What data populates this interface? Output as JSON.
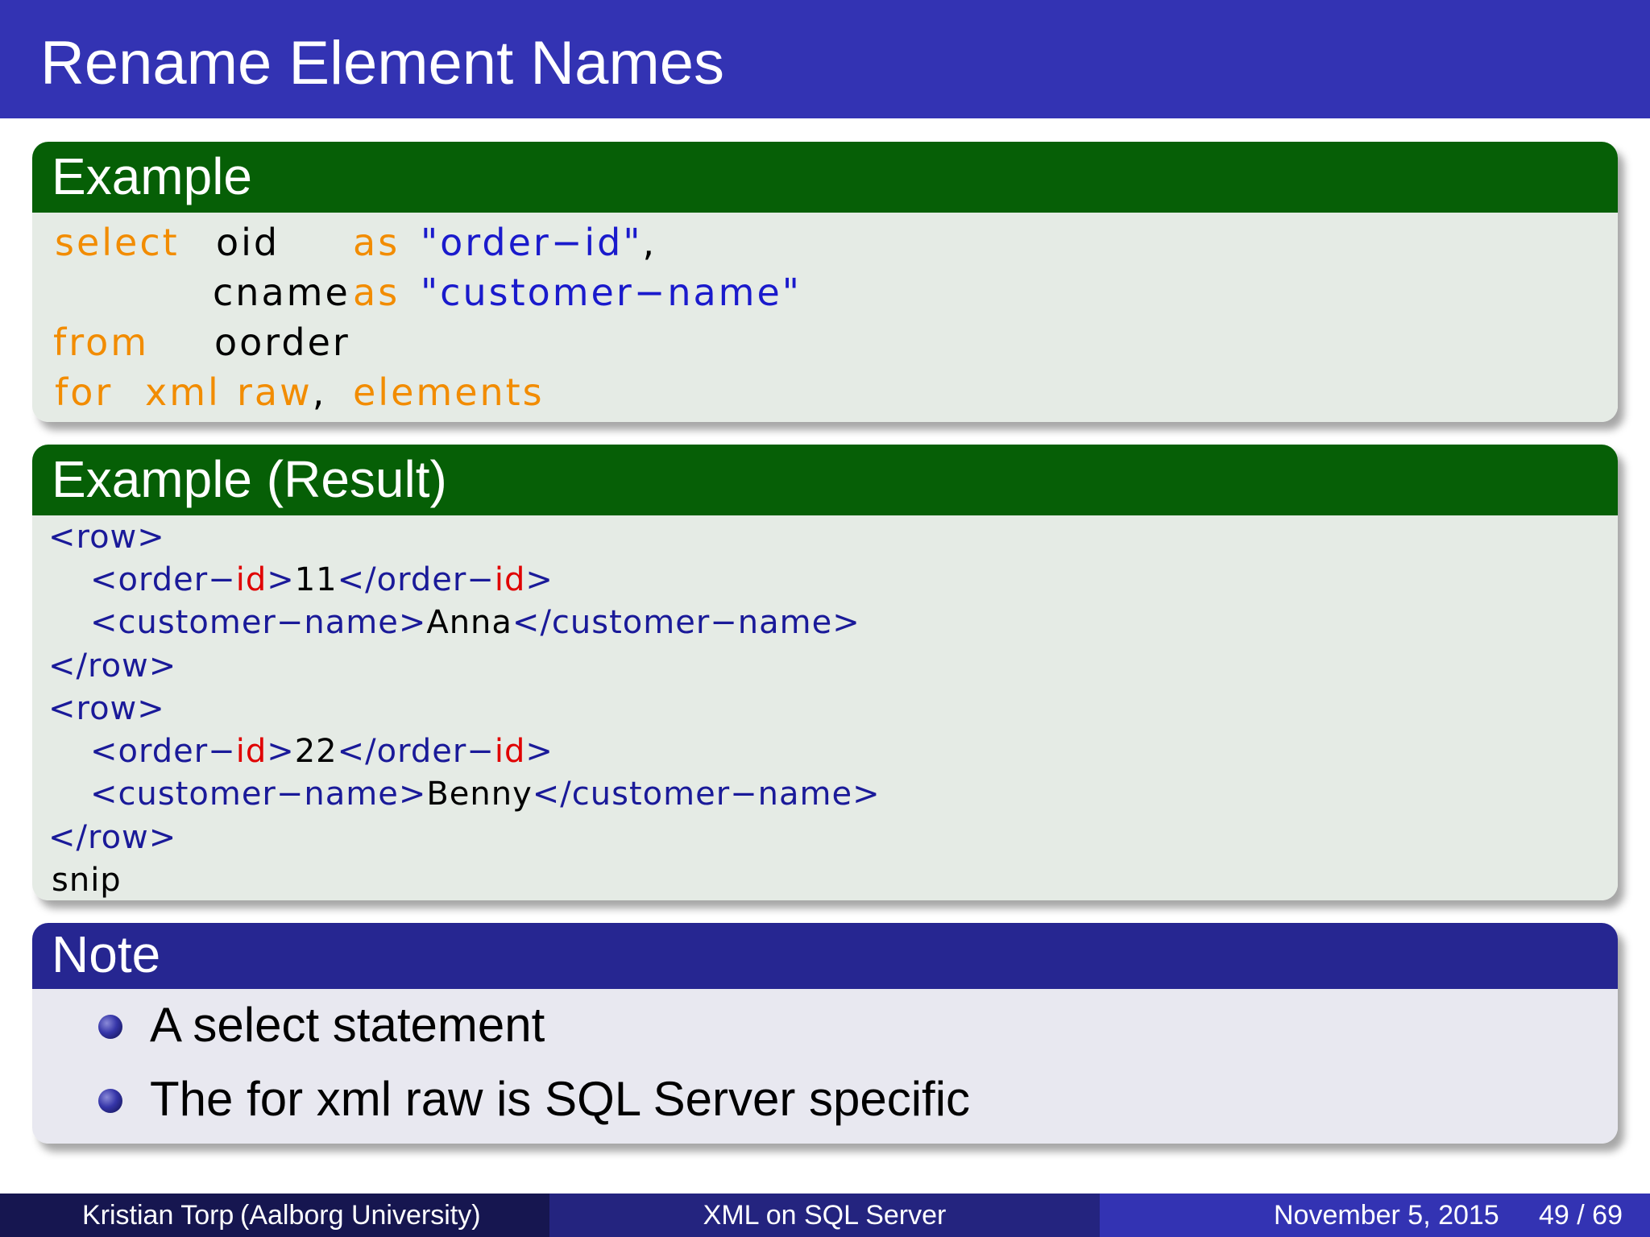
{
  "slide": {
    "title": "Rename Element Names"
  },
  "example_block": {
    "title": "Example",
    "code": {
      "l1": {
        "kw1": "select",
        "t1": "oid",
        "kw2": "as",
        "s1": "\"order−id\"",
        "p1": ","
      },
      "l2": {
        "t1": "cname",
        "kw1": "as",
        "s1": "\"customer−name\""
      },
      "l3": {
        "kw1": "from",
        "t1": "oorder"
      },
      "l4": {
        "kw1": "for",
        "kw2": "xml",
        "kw3": "raw",
        "p1": ",",
        "kw4": "elements"
      }
    }
  },
  "result_block": {
    "title": "Example (Result)",
    "code": {
      "l1": {
        "o": "<",
        "t": "row",
        "c": ">"
      },
      "l2": {
        "o1": "<",
        "t1a": "order−",
        "t1b": "id",
        "c1": ">",
        "v": "11",
        "o2": "</",
        "t2a": "order−",
        "t2b": "id",
        "c2": ">"
      },
      "l3": {
        "o1": "<",
        "t1": "customer−name",
        "c1": ">",
        "v": "Anna",
        "o2": "</",
        "t2": "customer−name",
        "c2": ">"
      },
      "l4": {
        "o": "</",
        "t": "row",
        "c": ">"
      },
      "l5": {
        "o": "<",
        "t": "row",
        "c": ">"
      },
      "l6": {
        "o1": "<",
        "t1a": "order−",
        "t1b": "id",
        "c1": ">",
        "v": "22",
        "o2": "</",
        "t2a": "order−",
        "t2b": "id",
        "c2": ">"
      },
      "l7": {
        "o1": "<",
        "t1": "customer−name",
        "c1": ">",
        "v": "Benny",
        "o2": "</",
        "t2": "customer−name",
        "c2": ">"
      },
      "l8": {
        "o": "</",
        "t": "row",
        "c": ">"
      },
      "l9": {
        "t": "snip"
      }
    }
  },
  "note_block": {
    "title": "Note",
    "items": [
      "A select statement",
      "The for xml raw is SQL Server specific"
    ]
  },
  "footer": {
    "author": "Kristian Torp",
    "affiliation": "(Aalborg University)",
    "talk_title": "XML on SQL Server",
    "date": "November 5, 2015",
    "page": "49 / 69"
  },
  "colors": {
    "title_bar": "#3333b3",
    "example_header": "#065f06",
    "example_body": "#e5ebe5",
    "note_header": "#262691",
    "note_body": "#e8e8f0",
    "sql_keyword": "#f28c00",
    "sql_string": "#1a1acc",
    "xml_tag": "#1a1a99",
    "xml_id": "#e00000",
    "footer_left": "#161650",
    "footer_mid": "#24247f",
    "footer_right": "#3333b3"
  }
}
